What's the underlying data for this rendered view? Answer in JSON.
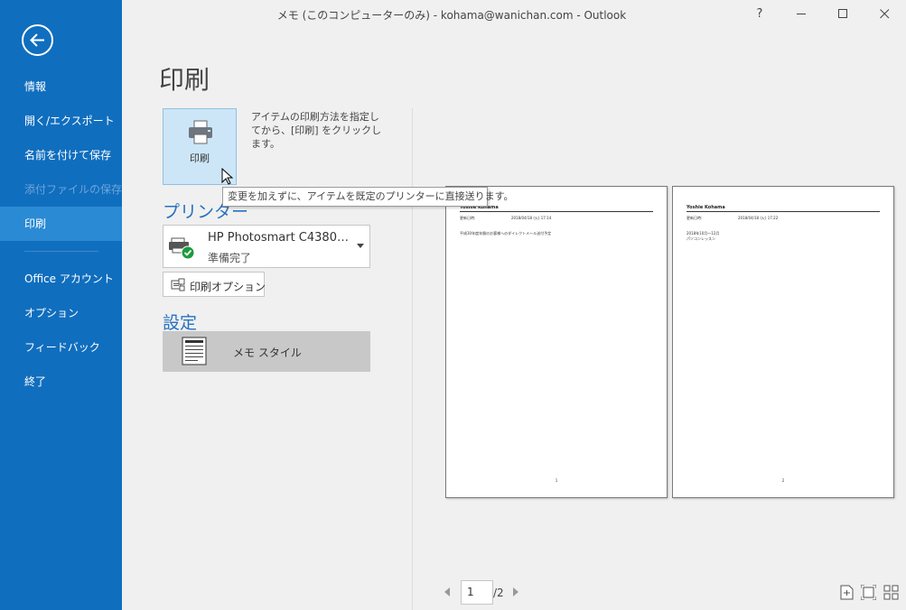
{
  "window": {
    "title": "メモ (このコンピューターのみ) - kohama@wanichan.com - Outlook",
    "help": "?"
  },
  "sidebar": {
    "items": [
      {
        "label": "情報",
        "state": "normal"
      },
      {
        "label": "開く/エクスポート",
        "state": "normal"
      },
      {
        "label": "名前を付けて保存",
        "state": "normal"
      },
      {
        "label": "添付ファイルの保存",
        "state": "disabled"
      },
      {
        "label": "印刷",
        "state": "active"
      },
      {
        "label": "Office アカウント",
        "state": "normal"
      },
      {
        "label": "オプション",
        "state": "normal"
      },
      {
        "label": "フィードバック",
        "state": "normal"
      },
      {
        "label": "終了",
        "state": "normal"
      }
    ]
  },
  "print": {
    "title": "印刷",
    "button_label": "印刷",
    "description": "アイテムの印刷方法を指定してから、[印刷] をクリックします。",
    "tooltip": "変更を加えずに、アイテムを既定のプリンターに直接送ります。"
  },
  "printer": {
    "heading": "プリンター",
    "name": "HP Photosmart C4380…",
    "status": "準備完了",
    "options_label": "印刷オプション"
  },
  "settings": {
    "heading": "設定",
    "style_label": "メモ スタイル"
  },
  "preview": {
    "pages": [
      {
        "header": "Yoshie Kohama",
        "meta_label": "更新日時:",
        "meta_value": "2018/04/18 (火) 17:14",
        "body": "平成30年度年間のお客様へのダイレクトメール送付予定",
        "number": "1"
      },
      {
        "header": "Yoshie Kohama",
        "meta_label": "更新日時:",
        "meta_value": "2018/04/18 (火) 17:22",
        "body": "2018年10月～12月\nパソコンレッスン",
        "number": "2"
      }
    ]
  },
  "pager": {
    "current": "1",
    "total": "/2"
  },
  "colors": {
    "sidebar_bg": "#106ebe",
    "sidebar_active": "#2a8ad4",
    "accent_heading": "#2672c0"
  }
}
